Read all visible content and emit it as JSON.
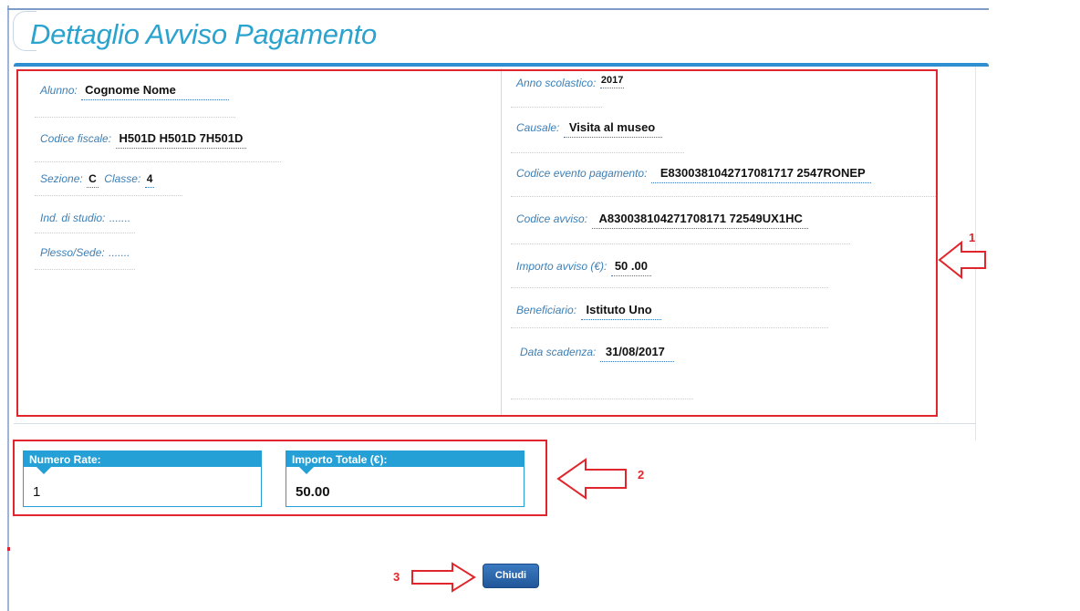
{
  "page": {
    "title": "Dettaglio Avviso Pagamento"
  },
  "left": {
    "alunno_label": "Alunno:",
    "alunno_value": "Cognome Nome",
    "codice_fiscale_label": "Codice fiscale:",
    "codice_fiscale_value": "H501D H501D 7H501D",
    "sezione_label": "Sezione:",
    "sezione_value": "C",
    "classe_label": "Classe:",
    "classe_value": "4",
    "ind_studio_label": "Ind. di studio:",
    "ind_studio_value": ".......",
    "plesso_label": "Plesso/Sede:",
    "plesso_value": "......."
  },
  "right": {
    "anno_label": "Anno scolastico:",
    "anno_value": "2017",
    "causale_label": "Causale:",
    "causale_value": "Visita al museo",
    "codice_evento_label": "Codice evento pagamento:",
    "codice_evento_value": "E8300381042717081717 2547RONEP",
    "codice_avviso_label": "Codice avviso:",
    "codice_avviso_value": "A830038104271708171 72549UX1HC",
    "importo_label": "Importo avviso (€):",
    "importo_value": "50 .00",
    "beneficiario_label": "Beneficiario:",
    "beneficiario_value": "Istituto Uno",
    "scadenza_label": "Data scadenza:",
    "scadenza_value": "31/08/2017"
  },
  "summary": {
    "rate_label": "Numero Rate:",
    "rate_value": "1",
    "totale_label": "Importo Totale (€):",
    "totale_value": "50.00"
  },
  "actions": {
    "close_label": "Chiudi"
  },
  "annotations": {
    "one": "1",
    "two": "2",
    "three": "3",
    "color": "#e0262c"
  }
}
